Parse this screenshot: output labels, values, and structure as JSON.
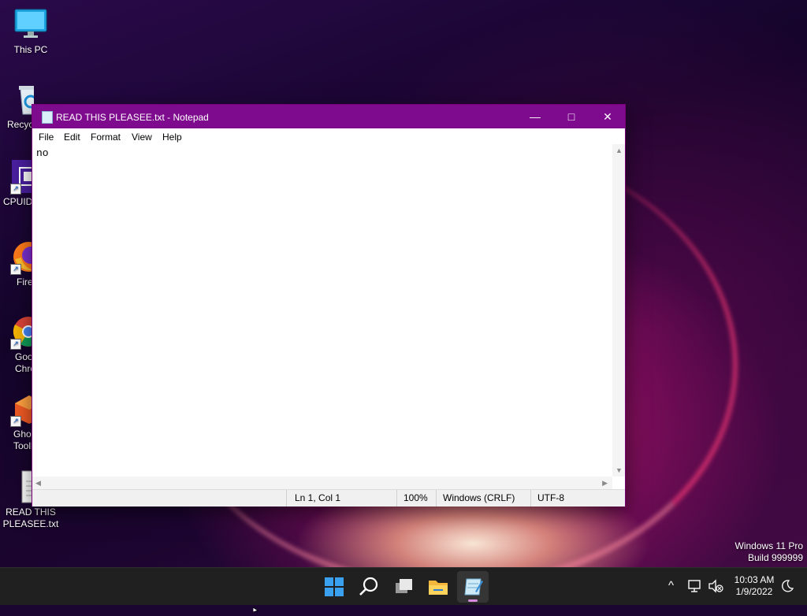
{
  "desktop": {
    "icons": [
      {
        "label": "This PC"
      },
      {
        "label": "Recycle Bin"
      },
      {
        "label": "CPUID"
      },
      {
        "label": "Firefox"
      },
      {
        "label": "Google Chrome"
      },
      {
        "label": "Ghost Toolbox"
      },
      {
        "label": "READ THIS PLEASEE.txt"
      }
    ],
    "watermark": {
      "line1": "Windows 11 Pro",
      "line2": "Build 999999"
    }
  },
  "notepad": {
    "title": "READ THIS PLEASEE.txt - Notepad",
    "buttons": {
      "minimize": "—",
      "maximize": "□",
      "close": "✕"
    },
    "menu": [
      "File",
      "Edit",
      "Format",
      "View",
      "Help"
    ],
    "content": "no",
    "status": {
      "position": "Ln 1, Col 1",
      "zoom": "100%",
      "line_ending": "Windows (CRLF)",
      "encoding": "UTF-8"
    }
  },
  "taskbar": {
    "clock": {
      "time": "10:03 AM",
      "date": "1/9/2022"
    },
    "tray": {
      "chevron": "^"
    }
  },
  "colors": {
    "titlebar": "#7e0a8e",
    "taskbar": "#202020",
    "indicator": "#d68ad9"
  }
}
